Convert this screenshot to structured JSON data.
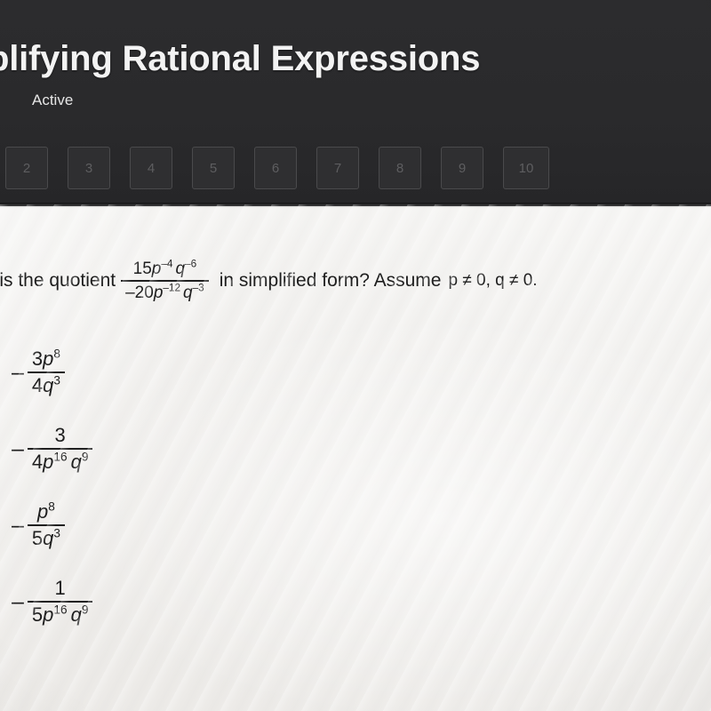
{
  "header": {
    "title": "plifying Rational Expressions",
    "subtitle": "Active",
    "pager": [
      {
        "label": "2"
      },
      {
        "label": "3"
      },
      {
        "label": "4"
      },
      {
        "label": "5"
      },
      {
        "label": "6"
      },
      {
        "label": "7"
      },
      {
        "label": "8"
      },
      {
        "label": "9"
      },
      {
        "label": "10"
      }
    ]
  },
  "question": {
    "lead": "at is the quotient",
    "fraction": {
      "numerator": {
        "coef": "15",
        "p_base": "p",
        "p_exp": "–4",
        "q_base": "q",
        "q_exp": "–6"
      },
      "denominator": {
        "coef": "–20",
        "p_base": "p",
        "p_exp": "–12",
        "q_base": "q",
        "q_exp": "–3"
      }
    },
    "middle": "in simplified form? Assume",
    "condition": "p ≠ 0, q ≠ 0."
  },
  "choices": [
    {
      "sign": "–",
      "numerator": {
        "coef": "3",
        "p_base": "p",
        "p_exp": "8",
        "q_base": "",
        "q_exp": ""
      },
      "denominator": {
        "coef": "4",
        "p_base": "",
        "p_exp": "",
        "q_base": "q",
        "q_exp": "3"
      }
    },
    {
      "sign": "–",
      "numerator": {
        "coef": "3",
        "p_base": "",
        "p_exp": "",
        "q_base": "",
        "q_exp": ""
      },
      "denominator": {
        "coef": "4",
        "p_base": "p",
        "p_exp": "16",
        "q_base": "q",
        "q_exp": "9"
      }
    },
    {
      "sign": "–",
      "numerator": {
        "coef": "",
        "p_base": "p",
        "p_exp": "8",
        "q_base": "",
        "q_exp": ""
      },
      "denominator": {
        "coef": "5",
        "p_base": "",
        "p_exp": "",
        "q_base": "q",
        "q_exp": "3"
      }
    },
    {
      "sign": "–",
      "numerator": {
        "coef": "1",
        "p_base": "",
        "p_exp": "",
        "q_base": "",
        "q_exp": ""
      },
      "denominator": {
        "coef": "5",
        "p_base": "p",
        "p_exp": "16",
        "q_base": "q",
        "q_exp": "9"
      }
    }
  ],
  "colors": {
    "header_bg": "#2a2a2c",
    "page_bg": "#f2f1ef",
    "text": "#1d1d1d",
    "pager_text": "#5e5e60"
  }
}
